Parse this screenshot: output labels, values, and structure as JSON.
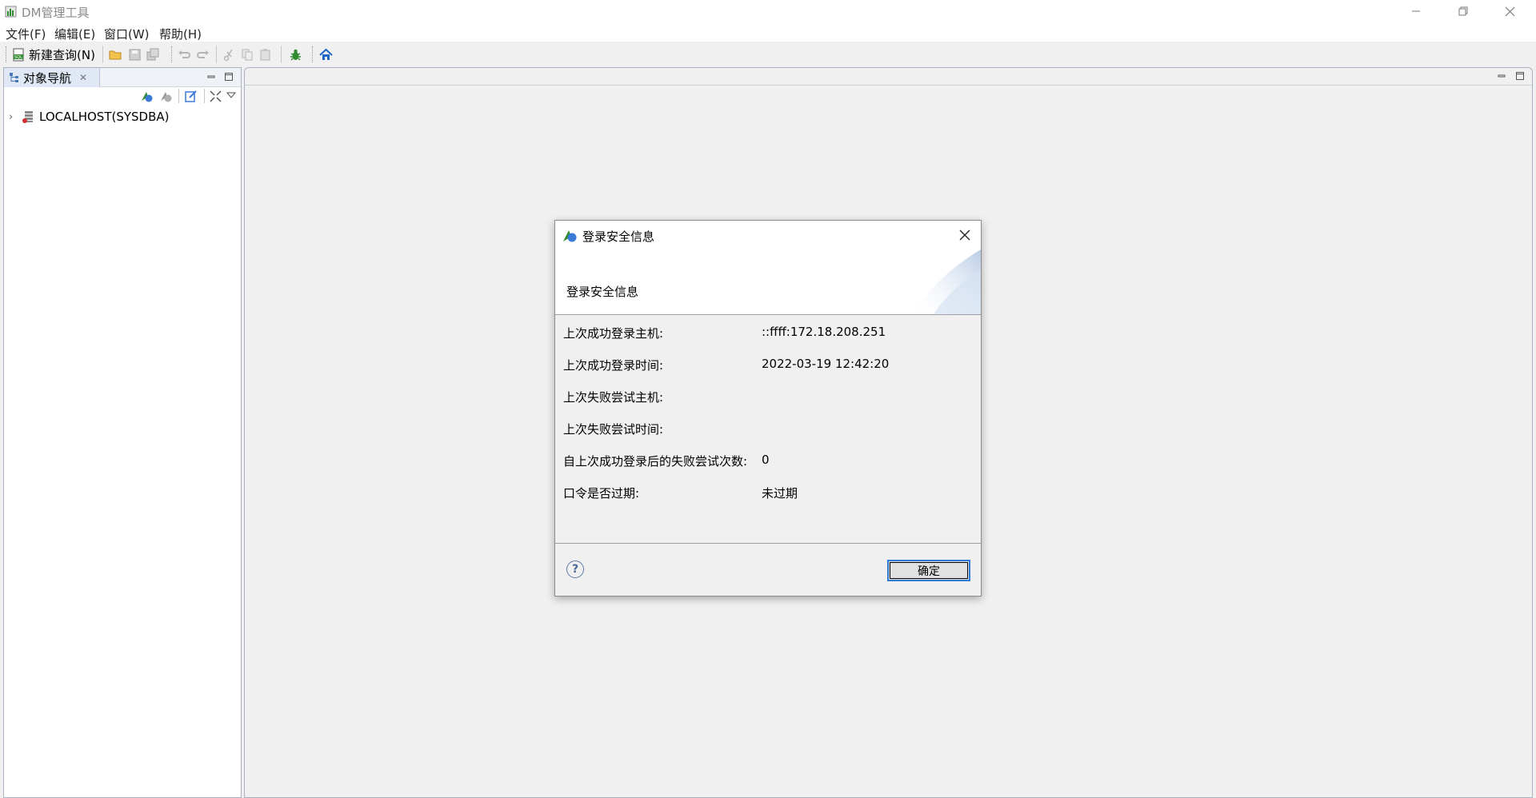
{
  "window": {
    "title": "DM管理工具",
    "icon": "dm-app-icon"
  },
  "menu": {
    "items": [
      "文件(F)",
      "编辑(E)",
      "窗口(W)",
      "帮助(H)"
    ]
  },
  "toolbar": {
    "new_query_label": "新建查询(N)",
    "icons": [
      "sql-new-icon",
      "open-folder-icon",
      "save-icon",
      "save-all-icon",
      "undo-icon",
      "redo-icon",
      "cut-icon",
      "copy-icon",
      "paste-icon",
      "debug-bug-icon",
      "home-icon"
    ]
  },
  "navigator": {
    "tab_label": "对象导航",
    "tree": [
      {
        "label": "LOCALHOST(SYSDBA)",
        "expanded": false
      }
    ]
  },
  "dialog": {
    "title": "登录安全信息",
    "heading": "登录安全信息",
    "rows": [
      {
        "label": "上次成功登录主机:",
        "value": "::ffff:172.18.208.251"
      },
      {
        "label": "上次成功登录时间:",
        "value": "2022-03-19 12:42:20"
      },
      {
        "label": "上次失败尝试主机:",
        "value": ""
      },
      {
        "label": "上次失败尝试时间:",
        "value": ""
      },
      {
        "label": "自上次成功登录后的失败尝试次数:",
        "value": "0"
      },
      {
        "label": "口令是否过期:",
        "value": "未过期"
      }
    ],
    "help_symbol": "?",
    "ok_label": "确定"
  },
  "colors": {
    "accent": "#2f7bd4",
    "toolbar_bg": "#f0f0f0",
    "tab_bg": "#dfe8f4"
  }
}
